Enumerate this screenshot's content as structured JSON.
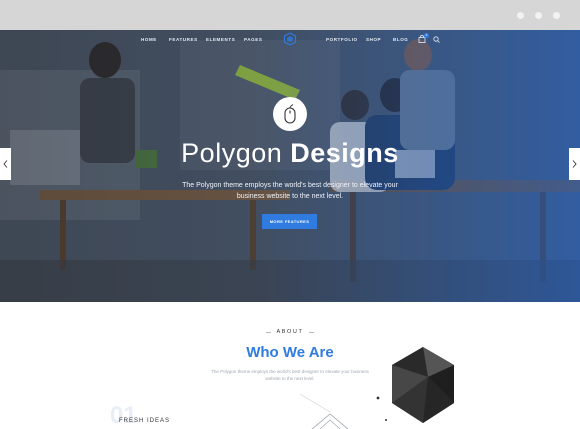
{
  "nav": {
    "left_items": [
      {
        "label": "HOME"
      },
      {
        "label": "FEATURES"
      },
      {
        "label": "ELEMENTS"
      },
      {
        "label": "PAGES"
      }
    ],
    "right_items": [
      {
        "label": "PORTFOLIO"
      },
      {
        "label": "SHOP"
      },
      {
        "label": "BLOG"
      }
    ],
    "cart_count": "0",
    "logo_icon": "polygon-logo-icon",
    "cart_icon": "shopping-bag-icon",
    "search_icon": "search-icon"
  },
  "hero": {
    "title_light": "Polygon",
    "title_bold": "Designs",
    "subtitle": "The Polygon theme employs the world's best designer to elevate your business website to the next level.",
    "cta_label": "MORE FEATURES",
    "badge_icon": "mouse-icon",
    "prev_icon": "chevron-left-icon",
    "next_icon": "chevron-right-icon"
  },
  "about": {
    "label": "ABOUT",
    "title": "Who We Are",
    "text": "The Polygon theme employs the world's best designer to elevate your business website to the next level.",
    "feature_number": "01",
    "feature_title": "FRESH IDEAS"
  },
  "colors": {
    "accent": "#2f7be0",
    "chrome": "#d6d6d6"
  }
}
